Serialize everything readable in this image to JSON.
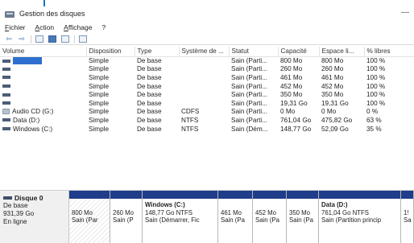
{
  "window": {
    "title": "Gestion des disques",
    "minimize_glyph": "—"
  },
  "menu": [
    "Fichier",
    "Action",
    "Affichage",
    "?"
  ],
  "toolbar": [
    {
      "icon": "back-arrow-icon",
      "glyph": "⇦"
    },
    {
      "icon": "forward-arrow-icon",
      "glyph": "⇨"
    },
    {
      "icon": "properties-icon"
    },
    {
      "icon": "help-icon"
    },
    {
      "icon": "list-view-icon"
    },
    {
      "icon": "disk-view-icon"
    }
  ],
  "table": {
    "columns": [
      "Volume",
      "Disposition",
      "Type",
      "Système de ...",
      "Statut",
      "Capacité",
      "Espace li...",
      "% libres"
    ],
    "rows": [
      {
        "volume": "",
        "selected": true,
        "icon": "volume-icon",
        "layout": "Simple",
        "type": "De base",
        "fs": "",
        "status": "Sain (Parti...",
        "capacity": "800 Mo",
        "free": "800 Mo",
        "pct": "100 %"
      },
      {
        "volume": "",
        "icon": "volume-icon",
        "layout": "Simple",
        "type": "De base",
        "fs": "",
        "status": "Sain (Parti...",
        "capacity": "260 Mo",
        "free": "260 Mo",
        "pct": "100 %"
      },
      {
        "volume": "",
        "icon": "volume-icon",
        "layout": "Simple",
        "type": "De base",
        "fs": "",
        "status": "Sain (Parti...",
        "capacity": "461 Mo",
        "free": "461 Mo",
        "pct": "100 %"
      },
      {
        "volume": "",
        "icon": "volume-icon",
        "layout": "Simple",
        "type": "De base",
        "fs": "",
        "status": "Sain (Parti...",
        "capacity": "452 Mo",
        "free": "452 Mo",
        "pct": "100 %"
      },
      {
        "volume": "",
        "icon": "volume-icon",
        "layout": "Simple",
        "type": "De base",
        "fs": "",
        "status": "Sain (Parti...",
        "capacity": "350 Mo",
        "free": "350 Mo",
        "pct": "100 %"
      },
      {
        "volume": "",
        "icon": "volume-icon",
        "layout": "Simple",
        "type": "De base",
        "fs": "",
        "status": "Sain (Parti...",
        "capacity": "19,31 Go",
        "free": "19,31 Go",
        "pct": "100 %"
      },
      {
        "volume": "Audio CD (G:)",
        "icon": "cd-drive-icon",
        "layout": "Simple",
        "type": "De base",
        "fs": "CDFS",
        "status": "Sain (Parti...",
        "capacity": "0 Mo",
        "free": "0 Mo",
        "pct": "0 %"
      },
      {
        "volume": "Data (D:)",
        "icon": "volume-icon",
        "layout": "Simple",
        "type": "De base",
        "fs": "NTFS",
        "status": "Sain (Parti...",
        "capacity": "761,04 Go",
        "free": "475,82 Go",
        "pct": "63 %"
      },
      {
        "volume": "Windows (C:)",
        "icon": "volume-icon",
        "layout": "Simple",
        "type": "De base",
        "fs": "NTFS",
        "status": "Sain (Dém...",
        "capacity": "148,77 Go",
        "free": "52,09 Go",
        "pct": "35 %"
      }
    ]
  },
  "disk": {
    "name": "Disque 0",
    "type": "De base",
    "size": "931,39 Go",
    "status": "En ligne",
    "partitions": [
      {
        "name": "",
        "size": "800 Mo",
        "status": "Sain (Par",
        "hatched": true
      },
      {
        "name": "",
        "size": "260 Mo",
        "status": "Sain (P"
      },
      {
        "name": "Windows (C:)",
        "size": "148,77 Go NTFS",
        "status": "Sain (Démarrer, Fic"
      },
      {
        "name": "",
        "size": "461 Mo",
        "status": "Sain (Pa"
      },
      {
        "name": "",
        "size": "452 Mo",
        "status": "Sain (Pa"
      },
      {
        "name": "",
        "size": "350 Mo",
        "status": "Sain (Pa"
      },
      {
        "name": "Data (D:)",
        "size": "761,04 Go NTFS",
        "status": "Sain (Partition princip"
      },
      {
        "name": "",
        "size": "1!",
        "status": "Sa"
      }
    ]
  },
  "colors": {
    "partition_cap": "#1f3d8a",
    "selection": "#2f6fd0",
    "volume_icon": "#4c5e78"
  }
}
